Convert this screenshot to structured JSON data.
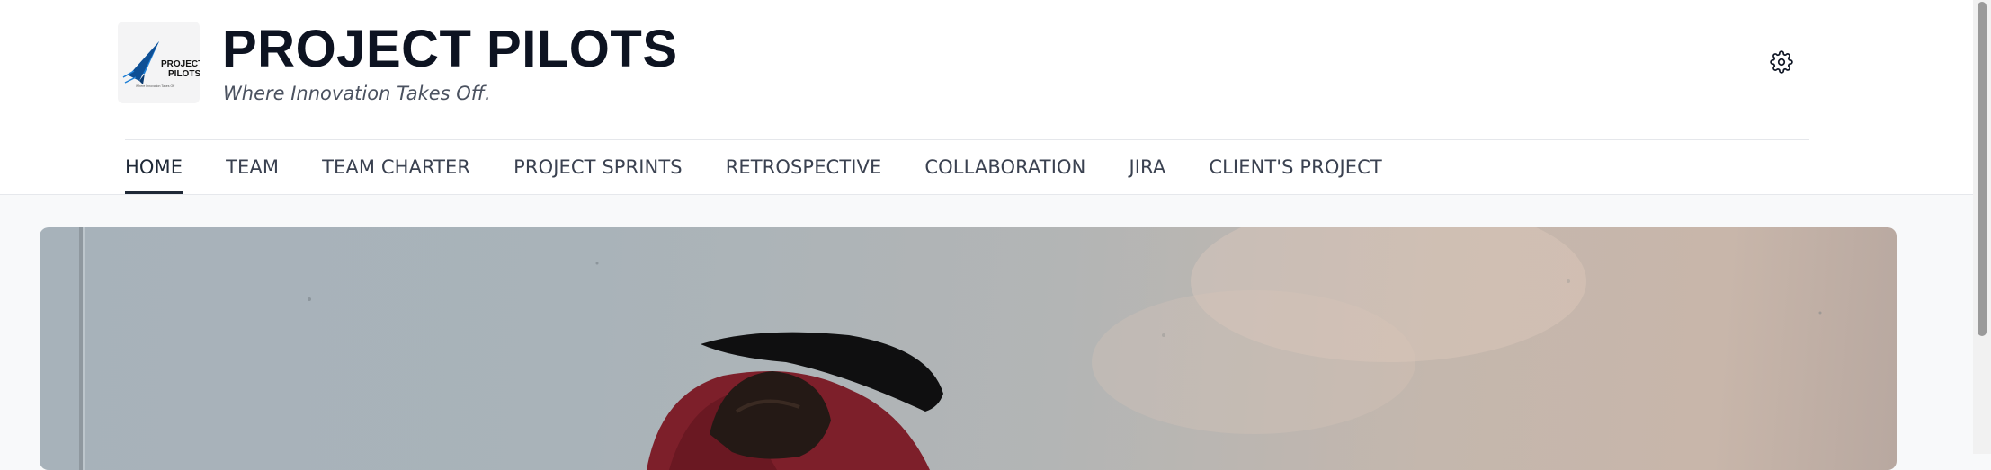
{
  "site": {
    "title": "PROJECT PILOTS",
    "tagline": "Where Innovation Takes Off.",
    "logo_text_line1": "PROJECT",
    "logo_text_line2": "PILOTS",
    "logo_subtext": "Where Innovation Takes Off",
    "logo_icon": "paper-plane-icon"
  },
  "header": {
    "settings_icon": "gear-icon"
  },
  "nav": {
    "items": [
      {
        "label": "HOME",
        "active": true
      },
      {
        "label": "TEAM",
        "active": false
      },
      {
        "label": "TEAM CHARTER",
        "active": false
      },
      {
        "label": "PROJECT SPRINTS",
        "active": false
      },
      {
        "label": "RETROSPECTIVE",
        "active": false
      },
      {
        "label": "COLLABORATION",
        "active": false
      },
      {
        "label": "JIRA",
        "active": false
      },
      {
        "label": "CLIENT'S PROJECT",
        "active": false
      }
    ]
  },
  "colors": {
    "title": "#0d1321",
    "nav_text": "#3a4150",
    "active_underline": "#1f2937",
    "page_background": "#f8f9fa",
    "logo_blue": "#1f7fd6"
  }
}
